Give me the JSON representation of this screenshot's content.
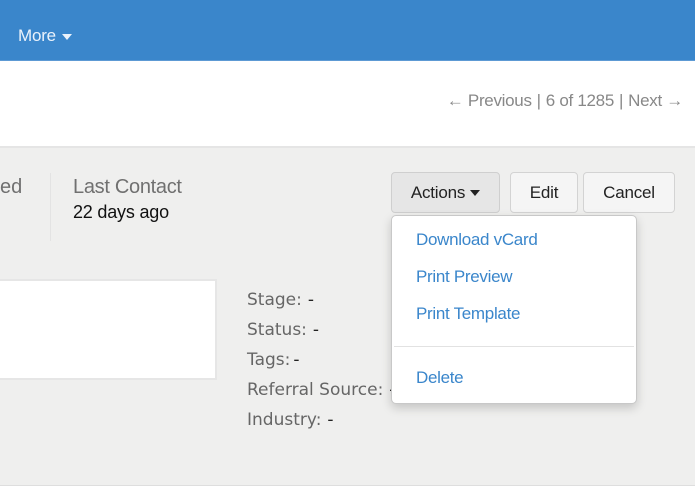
{
  "topbar": {
    "more_label": "More",
    "bg_color": "#3a86cb"
  },
  "pager": {
    "previous_label": "← Previous",
    "position": "6 of 1285",
    "next_label": "Next →",
    "separator": "|"
  },
  "summary": {
    "truncated_text": "ed",
    "last_contact_label": "Last Contact",
    "last_contact_value": "22 days ago"
  },
  "buttons": {
    "actions_label": "Actions",
    "edit_label": "Edit",
    "cancel_label": "Cancel"
  },
  "actions_menu": {
    "items": [
      {
        "label": "Download vCard"
      },
      {
        "label": "Print Preview"
      },
      {
        "label": "Print Template"
      },
      {
        "label": "Delete"
      }
    ],
    "link_color": "#3a86cb"
  },
  "fields": [
    {
      "label": "Stage:",
      "value": "-"
    },
    {
      "label": "Status:",
      "value": "-"
    },
    {
      "label": "Tags:",
      "value": "-"
    },
    {
      "label": "Referral Source:",
      "value": "-"
    },
    {
      "label": "Industry:",
      "value": "-"
    }
  ]
}
